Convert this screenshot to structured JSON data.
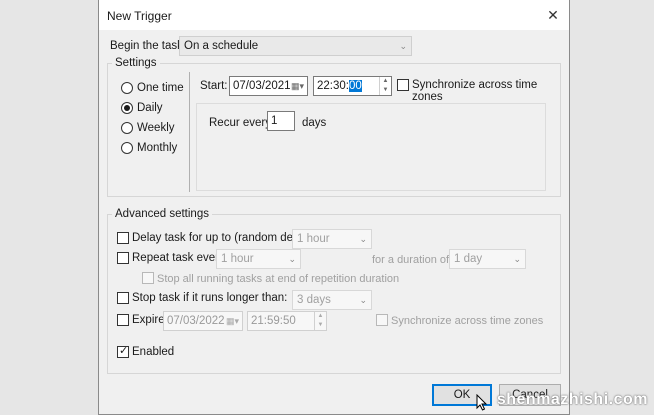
{
  "window": {
    "title": "New Trigger"
  },
  "begin": {
    "label": "Begin the task:",
    "value": "On a schedule"
  },
  "settings": {
    "group_label": "Settings",
    "radios": [
      {
        "label": "One time",
        "selected": false
      },
      {
        "label": "Daily",
        "selected": true
      },
      {
        "label": "Weekly",
        "selected": false
      },
      {
        "label": "Monthly",
        "selected": false
      }
    ],
    "start_label": "Start:",
    "start_date": "07/03/2021",
    "start_time_prefix": "22:30:",
    "start_time_selected": "00",
    "sync_label": "Synchronize across time zones",
    "recur_label": "Recur every:",
    "recur_value": "1",
    "recur_unit": "days"
  },
  "advanced": {
    "group_label": "Advanced settings",
    "delay": {
      "label": "Delay task for up to (random delay):",
      "value": "1 hour"
    },
    "repeat": {
      "label": "Repeat task every:",
      "value": "1 hour",
      "duration_label": "for a duration of:",
      "duration_value": "1 day"
    },
    "stop_all": {
      "label": "Stop all running tasks at end of repetition duration"
    },
    "stop_longer": {
      "label": "Stop task if it runs longer than:",
      "value": "3 days"
    },
    "expire": {
      "label": "Expire:",
      "date": "07/03/2022",
      "time": "21:59:50",
      "sync_label": "Synchronize across time zones"
    },
    "enabled": {
      "label": "Enabled",
      "checked": true
    }
  },
  "buttons": {
    "ok": "OK",
    "cancel": "Cancel"
  },
  "watermark": "shenmazhishi.com"
}
